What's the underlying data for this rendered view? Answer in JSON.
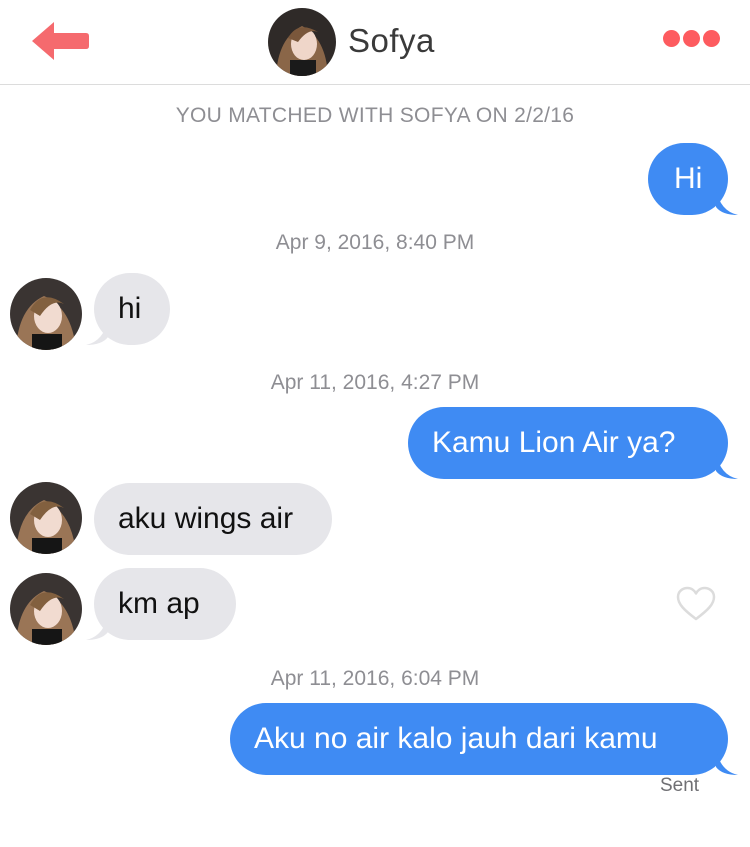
{
  "header": {
    "contact_name": "Sofya",
    "back_icon": "back-arrow-icon",
    "more_icon": "more-dots-icon",
    "accent_color": "#fd5b5f"
  },
  "match_notice": "YOU MATCHED WITH SOFYA ON 2/2/16",
  "timestamps": [
    "Apr 9, 2016, 8:40 PM",
    "Apr 11, 2016, 4:27 PM",
    "Apr 11, 2016, 6:04 PM"
  ],
  "messages": [
    {
      "from": "me",
      "text": "Hi"
    },
    {
      "from": "Sofya",
      "text": "hi"
    },
    {
      "from": "me",
      "text": "Kamu Lion Air ya?"
    },
    {
      "from": "Sofya",
      "text": "aku wings air"
    },
    {
      "from": "Sofya",
      "text": "km ap"
    },
    {
      "from": "me",
      "text": "Aku no air kalo jauh dari kamu"
    }
  ],
  "colors": {
    "outgoing_bubble": "#3f8bf3",
    "incoming_bubble": "#e6e6ea"
  },
  "like_icon": "heart-outline-icon",
  "delivery_status": "Sent"
}
